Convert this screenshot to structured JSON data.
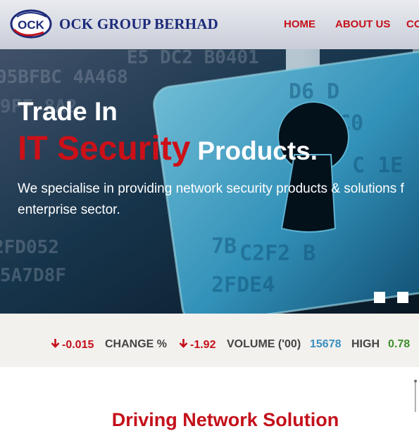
{
  "brand": {
    "logo_text": "OCK",
    "company_name": "OCK GROUP BERHAD",
    "colors": {
      "primary_blue": "#1c2b7a",
      "accent_red": "#c4101a"
    }
  },
  "nav": {
    "items": [
      {
        "label": "HOME"
      },
      {
        "label": "ABOUT US"
      },
      {
        "label": "CO"
      }
    ]
  },
  "hero": {
    "line1": "Trade In",
    "highlight": "IT Security",
    "line2_rest": "Products.",
    "description": "We specialise in providing network security products & solutions f enterprise sector.",
    "background_icon": "padlock-keyhole-icon",
    "slide_count": 2
  },
  "ticker": {
    "change_value": "-0.015",
    "change_pct_label": "CHANGE %",
    "change_pct_value": "-1.92",
    "volume_label": "VOLUME ('00)",
    "volume_value": "15678",
    "high_label": "HIGH",
    "high_value": "0.78",
    "down_icon": "arrow-down-icon"
  },
  "section": {
    "title": "Driving Network Solution"
  }
}
